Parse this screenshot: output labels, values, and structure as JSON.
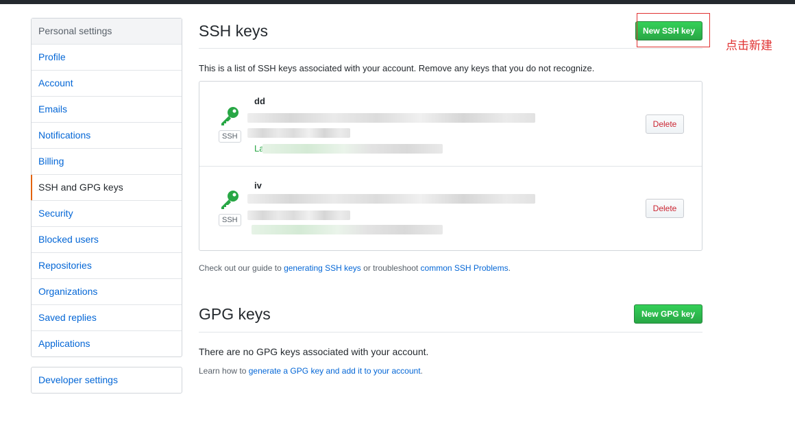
{
  "sidebar": {
    "heading": "Personal settings",
    "items": [
      {
        "label": "Profile"
      },
      {
        "label": "Account"
      },
      {
        "label": "Emails"
      },
      {
        "label": "Notifications"
      },
      {
        "label": "Billing"
      },
      {
        "label": "SSH and GPG keys",
        "selected": true
      },
      {
        "label": "Security"
      },
      {
        "label": "Blocked users"
      },
      {
        "label": "Repositories"
      },
      {
        "label": "Organizations"
      },
      {
        "label": "Saved replies"
      },
      {
        "label": "Applications"
      }
    ],
    "developer_settings": "Developer settings"
  },
  "ssh": {
    "title": "SSH keys",
    "new_button": "New SSH key",
    "description": "This is a list of SSH keys associated with your account. Remove any keys that you do not recognize.",
    "keys": [
      {
        "title": "dd",
        "badge": "SSH",
        "last_used_prefix": "La",
        "delete_label": "Delete"
      },
      {
        "title": "iv",
        "badge": "SSH",
        "delete_label": "Delete"
      }
    ],
    "guide": {
      "prefix": "Check out our guide to ",
      "link1": "generating SSH keys",
      "middle": " or troubleshoot ",
      "link2": "common SSH Problems",
      "suffix": "."
    }
  },
  "gpg": {
    "title": "GPG keys",
    "new_button": "New GPG key",
    "empty_text": "There are no GPG keys associated with your account.",
    "learn": {
      "prefix": "Learn how to ",
      "link": "generate a GPG key and add it to your account",
      "suffix": "."
    }
  },
  "annotation": {
    "text": "点击新建"
  },
  "colors": {
    "accent_green": "#28a745",
    "link_blue": "#0366d6",
    "danger_red": "#cb2431",
    "selected_marker": "#e36209",
    "annotation_red": "#e03131"
  }
}
